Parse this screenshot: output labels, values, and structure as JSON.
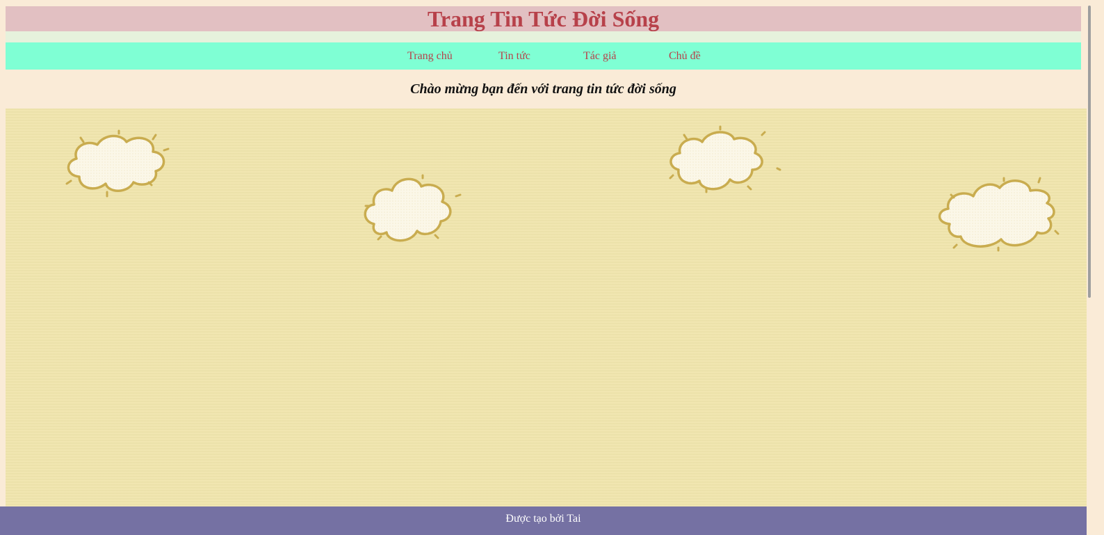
{
  "header": {
    "title": "Trang Tin Tức Đời Sống"
  },
  "nav": {
    "items": [
      {
        "label": "Trang chủ"
      },
      {
        "label": "Tin tức"
      },
      {
        "label": "Tác giả"
      },
      {
        "label": "Chủ đề"
      }
    ]
  },
  "welcome": {
    "text": "Chào mừng bạn đến với trang tin tức đời sống"
  },
  "footer": {
    "text": "Được tạo bởi Tai"
  },
  "colors": {
    "header_bg": "#e2c0c2",
    "title_color": "#b7414a",
    "nav_bg": "#7fffd4",
    "page_bg": "#faebd7",
    "content_bg": "#f0e5ad",
    "footer_bg": "#7571a3",
    "cloud_outline": "#c9ac4f"
  },
  "icons": [
    "cloud-icon"
  ]
}
